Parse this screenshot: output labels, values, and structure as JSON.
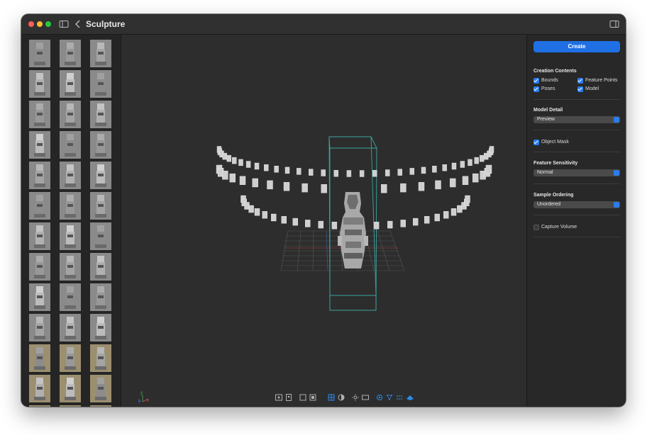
{
  "window": {
    "title": "Sculpture"
  },
  "titlebar_icons": {
    "sidebar_toggle": "sidebar-toggle-icon",
    "back": "chevron-left-icon",
    "inspector_toggle": "inspector-toggle-icon"
  },
  "inspector": {
    "create_label": "Create",
    "creation_contents": {
      "label": "Creation Contents",
      "options": [
        {
          "label": "Bounds",
          "checked": true
        },
        {
          "label": "Feature Points",
          "checked": true
        },
        {
          "label": "Poses",
          "checked": true
        },
        {
          "label": "Model",
          "checked": true
        }
      ]
    },
    "model_detail": {
      "label": "Model Detail",
      "value": "Preview"
    },
    "object_mask": {
      "label": "Object Mask",
      "checked": true
    },
    "feature_sensitivity": {
      "label": "Feature Sensitivity",
      "value": "Normal"
    },
    "sample_ordering": {
      "label": "Sample Ordering",
      "value": "Unordered"
    },
    "capture_volume": {
      "label": "Capture Volume",
      "checked": false
    }
  },
  "viewport": {
    "axis_labels": [
      "y",
      "b",
      "x"
    ],
    "toolbar_icons": [
      "frame-icon",
      "portrait-icon",
      "square-icon",
      "layers-icon",
      "grid-icon",
      "contrast-icon",
      "sun-icon",
      "rectangle-icon",
      "camera-poses-icon",
      "feature-points-icon",
      "mesh-grid-icon",
      "model-icon"
    ]
  },
  "accent_color": "#1f6fe5"
}
